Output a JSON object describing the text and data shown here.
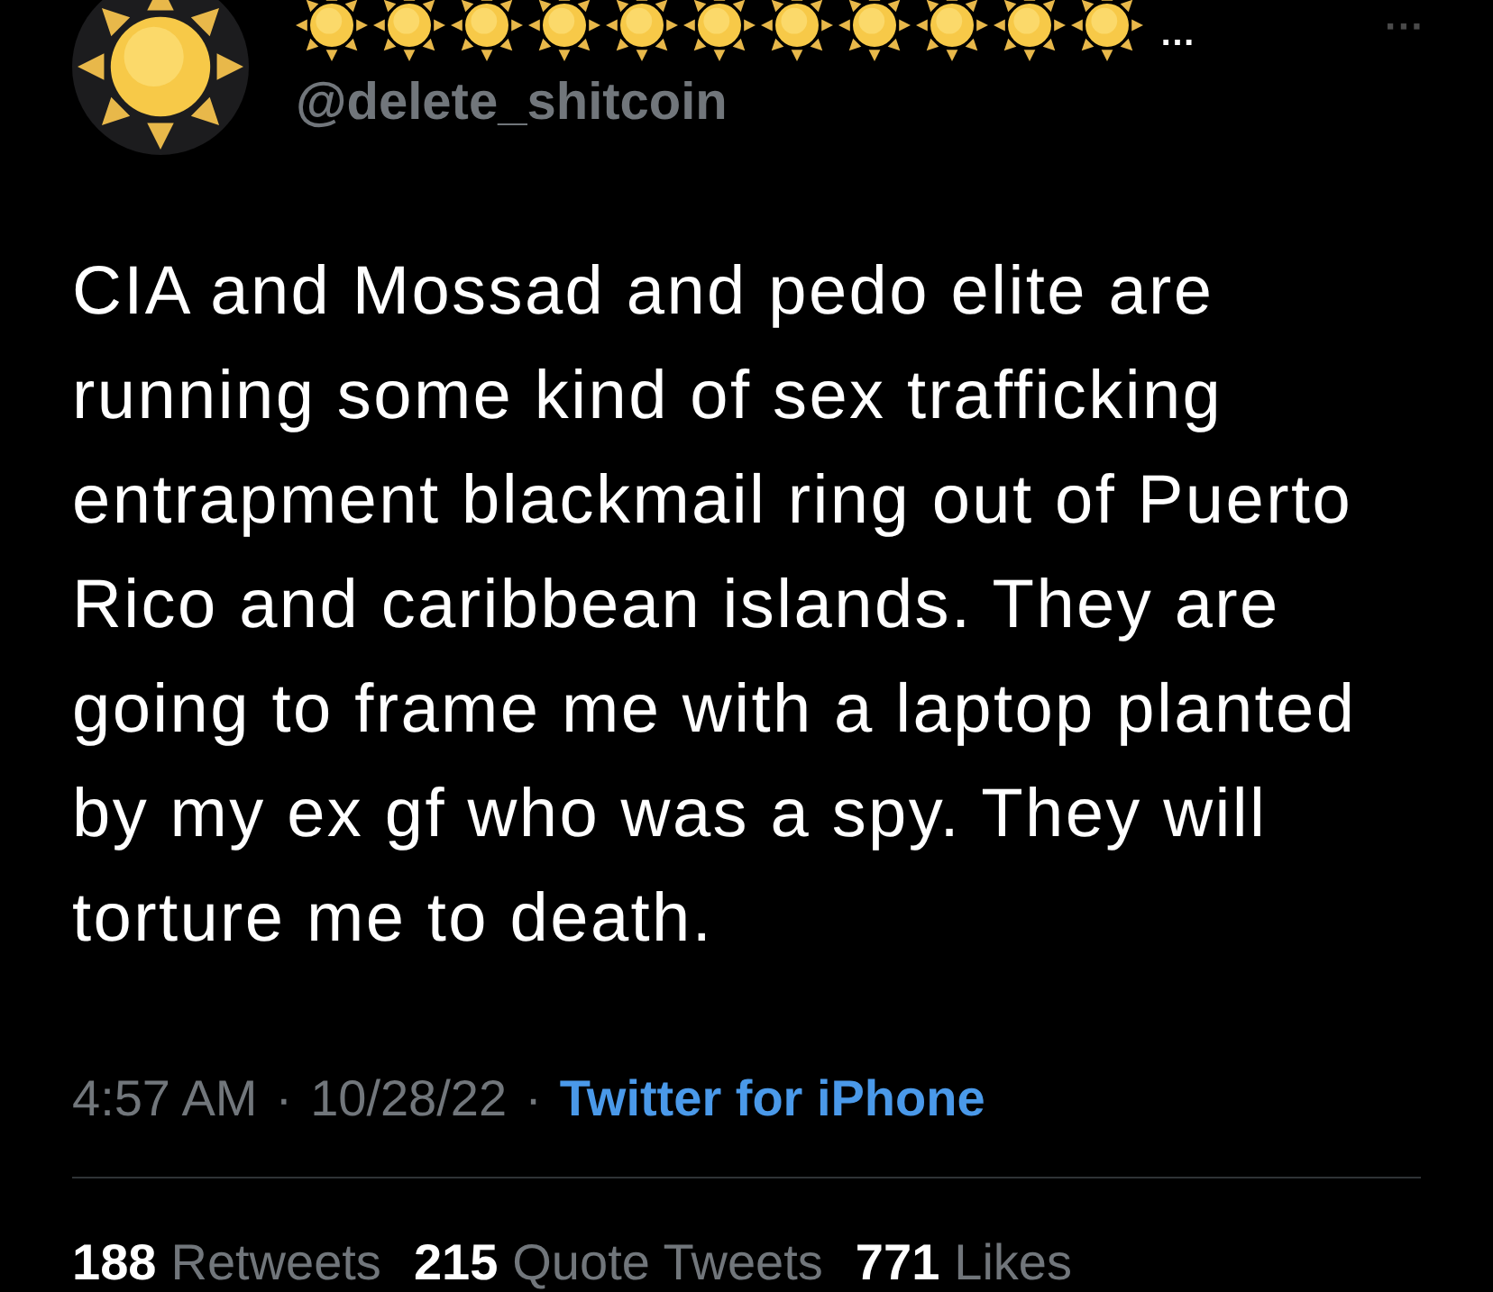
{
  "author": {
    "name_suffix": "…",
    "handle": "@delete_shitcoin",
    "more": "···"
  },
  "tweet": {
    "text": "CIA and Mossad and pedo elite are running some kind of sex trafficking entrapment blackmail ring out of Puerto Rico and caribbean islands. They are going to frame me with a laptop planted by my ex gf who was a spy. They will torture me to death.",
    "time": "4:57 AM",
    "date": "10/28/22",
    "source": "Twitter for iPhone",
    "separators": [
      "·",
      "·"
    ]
  },
  "stats": [
    {
      "count": "188",
      "label": "Retweets"
    },
    {
      "count": "215",
      "label": "Quote Tweets"
    },
    {
      "count": "771",
      "label": "Likes"
    }
  ]
}
